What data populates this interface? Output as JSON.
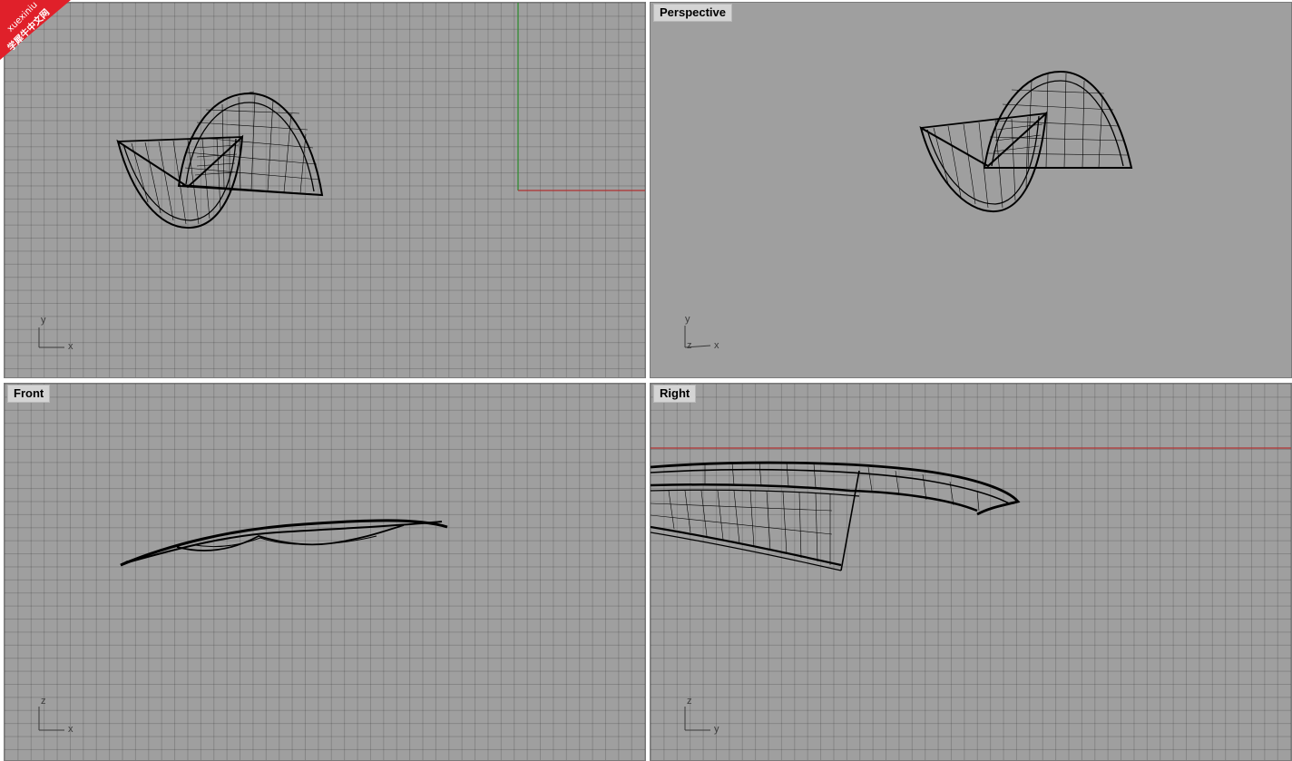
{
  "watermark": {
    "line1": "xuexiniu",
    "line2": "学犀牛中文网",
    "color": "#e0202a"
  },
  "viewports": {
    "top": {
      "title": "",
      "axis_h": "x",
      "axis_v": "y"
    },
    "perspective": {
      "title": "Perspective",
      "axis_h": "x",
      "axis_v": "y",
      "axis_z": "z"
    },
    "front": {
      "title": "Front",
      "axis_h": "x",
      "axis_v": "z"
    },
    "right": {
      "title": "Right",
      "axis_h": "y",
      "axis_v": "z"
    }
  },
  "colors": {
    "viewport_bg": "#9f9f9f",
    "grid_line": "#8a8a8a",
    "x_axis_red": "#b03030",
    "y_axis_green": "#2a8a2a",
    "wire": "#000000"
  }
}
